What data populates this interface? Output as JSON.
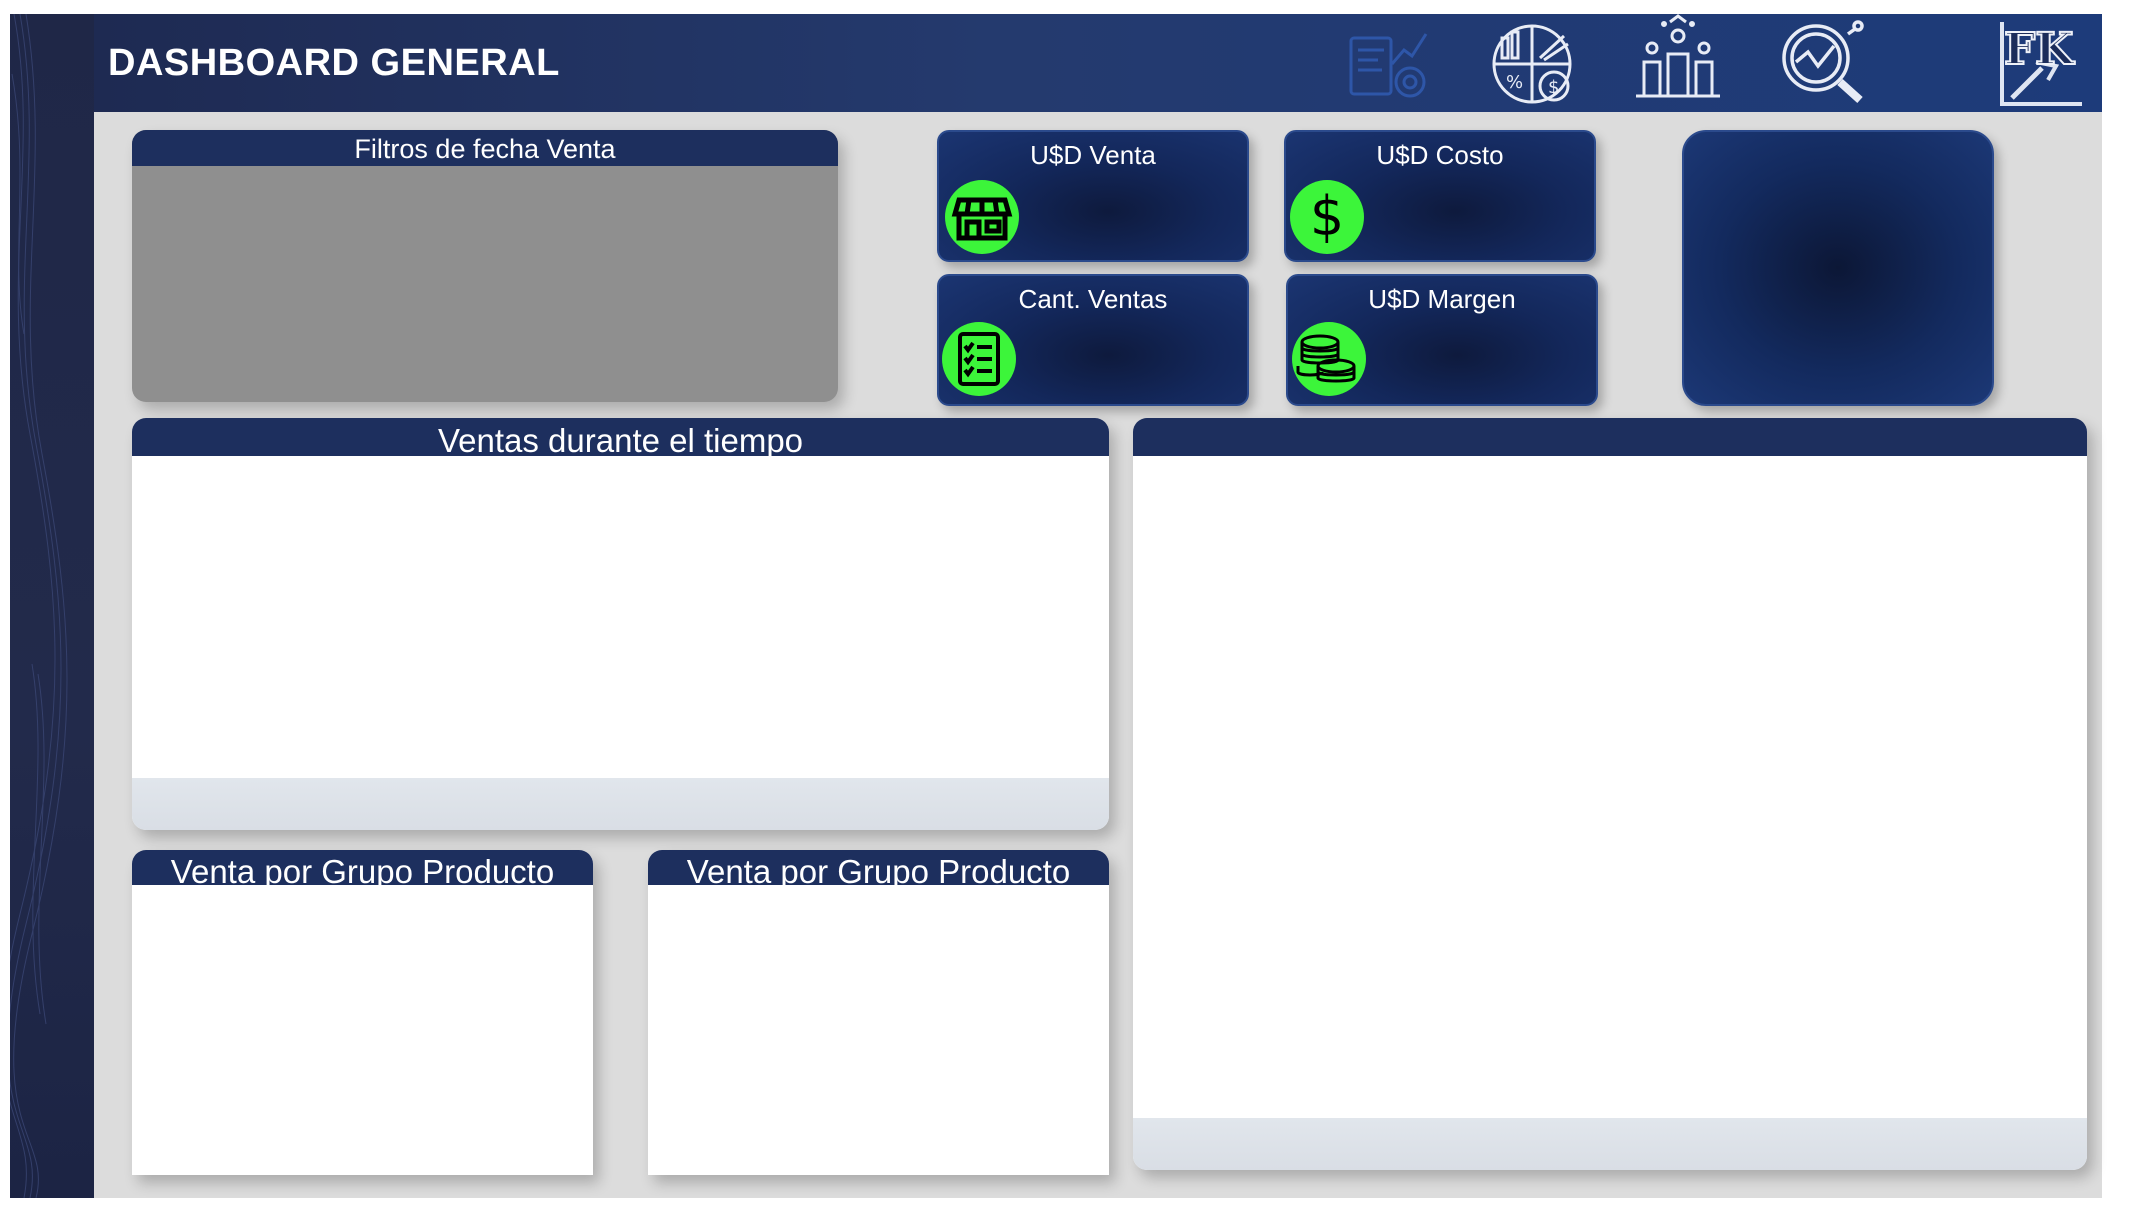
{
  "header": {
    "title": "DASHBOARD GENERAL",
    "nav_icons": [
      "report-chart-icon",
      "pie-finance-icon",
      "team-growth-icon",
      "analytics-search-icon"
    ],
    "logo_text": "FK"
  },
  "filters_panel": {
    "title": "Filtros de fecha Venta"
  },
  "kpis": [
    {
      "label": "U$D Venta",
      "icon": "storefront-icon"
    },
    {
      "label": "U$D Costo",
      "icon": "dollar-sign-icon"
    },
    {
      "label": "Cant. Ventas",
      "icon": "checklist-icon"
    },
    {
      "label": "U$D Margen",
      "icon": "coins-stack-icon"
    }
  ],
  "panels": {
    "sales_over_time": {
      "title": "Ventas durante el tiempo"
    },
    "right_panel": {
      "title": ""
    },
    "group_left": {
      "title": "Venta por Grupo Producto"
    },
    "group_right": {
      "title": "Venta por Grupo Producto"
    }
  },
  "colors": {
    "header_bg": "#1e2a52",
    "panel_head": "#1d2f5e",
    "kpi_bg": "#13275a",
    "icon_accent": "#3cf53a",
    "workspace_bg": "#dcdcdc",
    "rail_bg": "#1f2747"
  }
}
